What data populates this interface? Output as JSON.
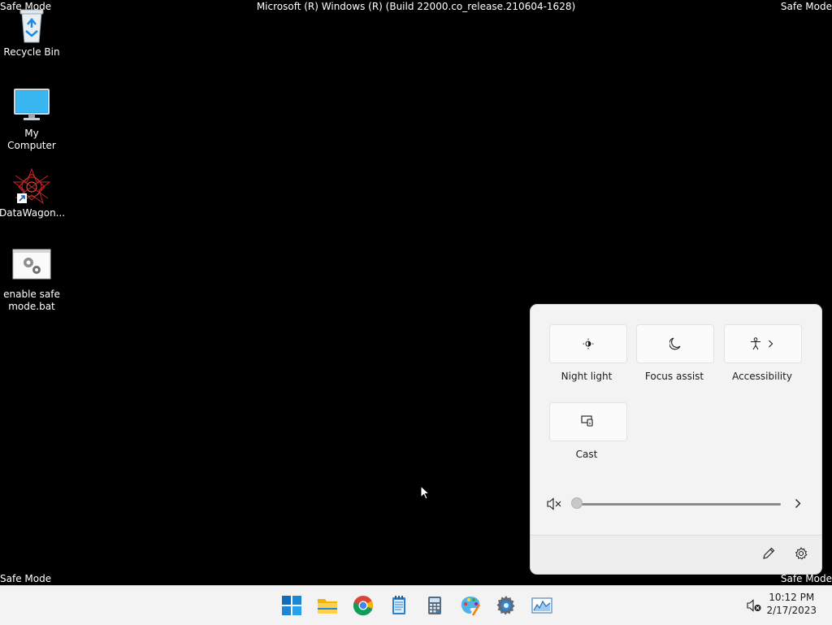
{
  "screen": {
    "title": "Microsoft (R) Windows (R) (Build 22000.co_release.210604-1628)",
    "safe_mode_label": "Safe Mode"
  },
  "desktop_icons": [
    {
      "label": "Recycle Bin",
      "icon": "recycle-bin-icon"
    },
    {
      "label": "My Computer",
      "icon": "monitor-icon"
    },
    {
      "label": "DataWagon...",
      "icon": "app-shortcut-icon"
    },
    {
      "label": "enable safe mode.bat",
      "icon": "batch-file-icon"
    }
  ],
  "quick_settings": {
    "tiles": [
      {
        "label": "Night light",
        "icon": "brightness-icon"
      },
      {
        "label": "Focus assist",
        "icon": "moon-icon"
      },
      {
        "label": "Accessibility",
        "icon": "accessibility-icon",
        "has_chevron": true
      },
      {
        "label": "Cast",
        "icon": "cast-icon"
      }
    ],
    "volume": {
      "muted": true,
      "level": 0
    },
    "footer": {
      "edit_icon": "pencil-icon",
      "settings_icon": "gear-icon"
    }
  },
  "taskbar": {
    "apps": [
      "start-icon",
      "file-explorer-icon",
      "chrome-icon",
      "notepad-icon",
      "calculator-icon",
      "paint-icon",
      "settings-icon",
      "task-manager-icon"
    ],
    "clock": {
      "time": "10:12 PM",
      "date": "2/17/2023"
    },
    "tray": "volume-muted-icon"
  },
  "colors": {
    "desktop": "#000000",
    "flyout": "#f3f3f3",
    "taskbar": "#f3f3f3",
    "accent": "#0067c0"
  }
}
